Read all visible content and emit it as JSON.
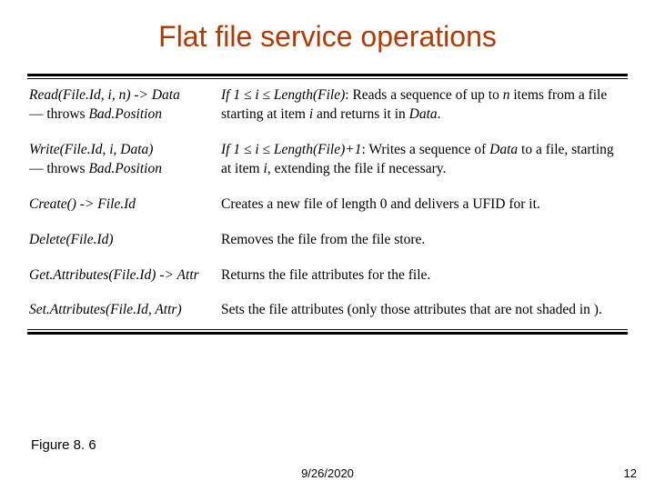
{
  "title": "Flat file service operations",
  "ops": [
    {
      "sig": "Read(File.Id, i, n) -> Data",
      "throws": "Bad.Position",
      "desc_lead_it": "If 1 ≤ i ≤ Length(File)",
      "desc_rest_html": ": Reads a sequence of up to <span class='it'>n</span> items from a file starting at item <span class='it'>i</span> and returns it in <span class='it'>Data</span>."
    },
    {
      "sig": "Write(File.Id, i, Data)",
      "throws": "Bad.Position",
      "desc_lead_it": "If 1 ≤ i ≤ Length(File)+1",
      "desc_rest_html": ": Writes a sequence of <span class='it'>Data</span> to a file, starting at item <span class='it'>i</span>, extending the file if necessary."
    },
    {
      "sig": "Create() -> File.Id",
      "throws": null,
      "desc_lead_it": "",
      "desc_rest_html": "Creates a new file of length 0 and delivers a UFID for it."
    },
    {
      "sig": "Delete(File.Id)",
      "throws": null,
      "desc_lead_it": "",
      "desc_rest_html": "Removes the file from the file store."
    },
    {
      "sig": "Get.Attributes(File.Id) -> Attr",
      "throws": null,
      "desc_lead_it": "",
      "desc_rest_html": "Returns the file attributes for the file."
    },
    {
      "sig": "Set.Attributes(File.Id, Attr)",
      "throws": null,
      "desc_lead_it": "",
      "desc_rest_html": "Sets the file attributes (only those attributes that are not shaded in )."
    }
  ],
  "throws_prefix": "— throws",
  "figure_label": "Figure 8. 6",
  "footer_date": "9/26/2020",
  "footer_pagenum": "12"
}
